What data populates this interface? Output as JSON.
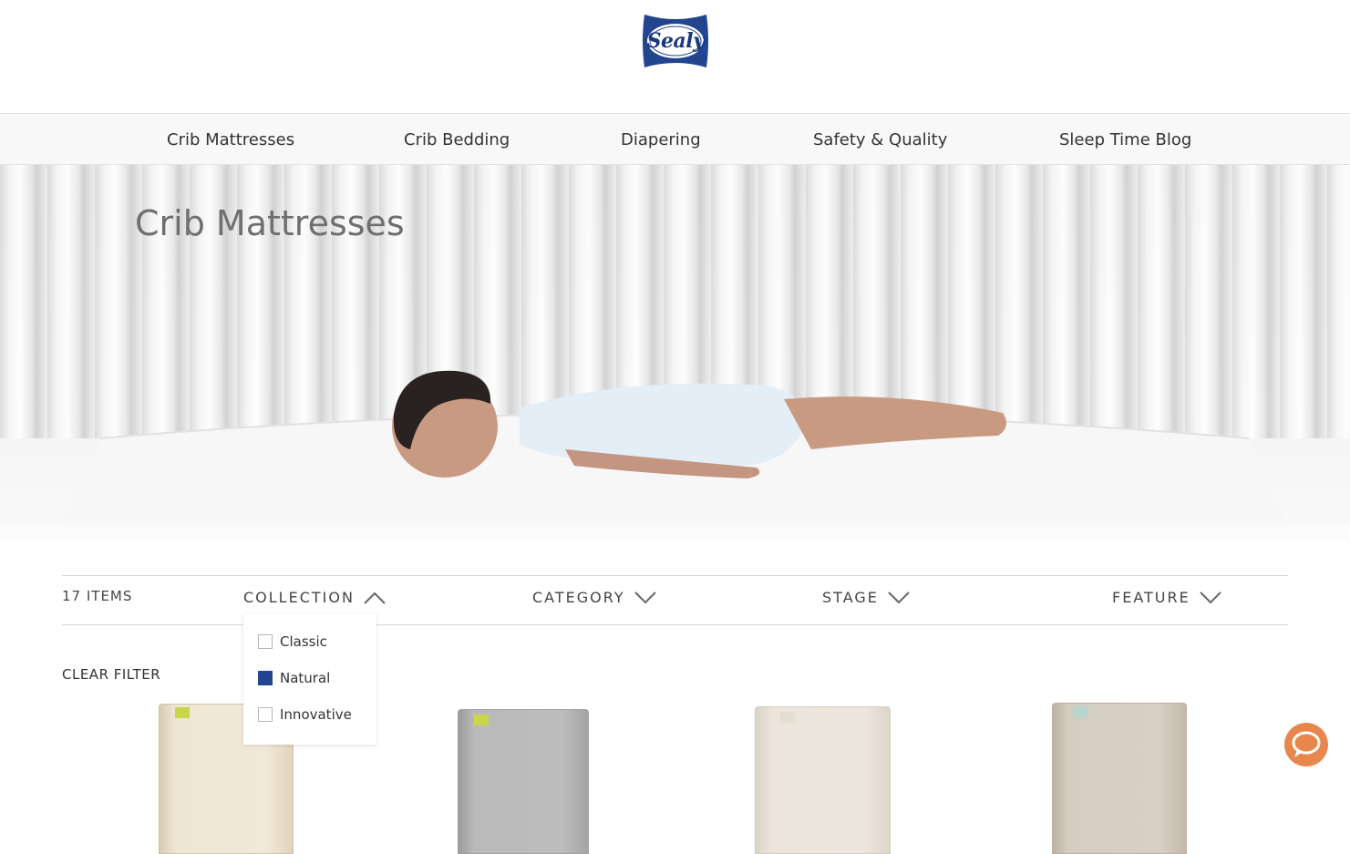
{
  "brand": {
    "logo_text": "Sealy"
  },
  "nav": {
    "items": [
      {
        "label": "Crib Mattresses"
      },
      {
        "label": "Crib Bedding"
      },
      {
        "label": "Diapering"
      },
      {
        "label": "Safety & Quality"
      },
      {
        "label": "Sleep Time Blog"
      }
    ]
  },
  "hero": {
    "title": "Crib Mattresses"
  },
  "filters": {
    "item_count": "17 ITEMS",
    "collection": "COLLECTION",
    "category": "CATEGORY",
    "stage": "STAGE",
    "feature": "FEATURE",
    "collection_options": [
      {
        "label": "Classic",
        "checked": false
      },
      {
        "label": "Natural",
        "checked": true
      },
      {
        "label": "Innovative",
        "checked": false
      }
    ],
    "clear_label": "CLEAR FILTER"
  },
  "colors": {
    "accent": "#23448f",
    "chat": "#e8874d",
    "logo_blue": "#1b3a7a"
  },
  "icons": [
    "chevron-up-icon",
    "chevron-down-icon",
    "chat-icon"
  ]
}
